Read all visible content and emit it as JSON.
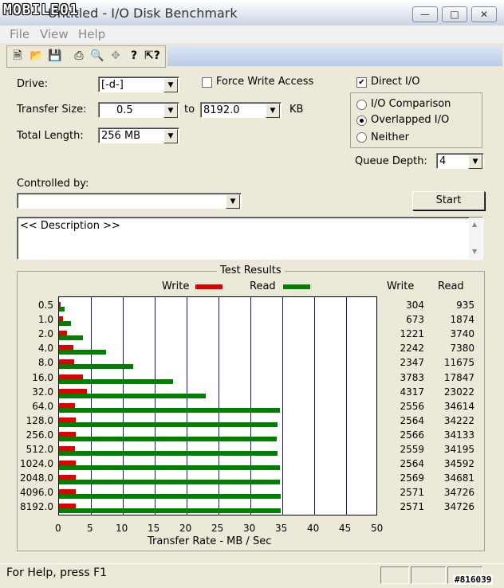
{
  "window": {
    "title": "Untitled - I/O Disk Benchmark",
    "watermark": "MOBILE01"
  },
  "menu": [
    "File",
    "View",
    "Help"
  ],
  "toolbar": [
    "new-icon",
    "open-icon",
    "save-icon",
    "print-icon",
    "print-preview-icon",
    "move-icon",
    "help-icon",
    "context-help-icon"
  ],
  "settings": {
    "drive_label": "Drive:",
    "drive_value": "[-d-]",
    "force_write_label": "Force Write Access",
    "transfer_label": "Transfer Size:",
    "transfer_from": "0.5",
    "to_label": "to",
    "transfer_to": "8192.0",
    "kb_label": "KB",
    "length_label": "Total Length:",
    "length_value": "256 MB",
    "direct_io_label": "Direct I/O",
    "io_comparison_label": "I/O Comparison",
    "overlapped_label": "Overlapped I/O",
    "neither_label": "Neither",
    "queue_label": "Queue Depth:",
    "queue_value": "4",
    "controlled_label": "Controlled by:",
    "controlled_value": "",
    "start_label": "Start",
    "description": "<< Description >>"
  },
  "chart_data": {
    "type": "bar",
    "title": "Test Results",
    "xlabel": "Transfer Rate - MB / Sec",
    "xlim": [
      0,
      50
    ],
    "xticks": [
      "0",
      "5",
      "10",
      "15",
      "20",
      "25",
      "30",
      "35",
      "40",
      "45",
      "50"
    ],
    "categories": [
      "0.5",
      "1.0",
      "2.0",
      "4.0",
      "8.0",
      "16.0",
      "32.0",
      "64.0",
      "128.0",
      "256.0",
      "512.0",
      "1024.0",
      "2048.0",
      "4096.0",
      "8192.0"
    ],
    "legend_write": "Write",
    "legend_read": "Read",
    "col_write": "Write",
    "col_read": "Read",
    "series": [
      {
        "name": "Write",
        "color": "#e00000",
        "values": [
          304,
          673,
          1221,
          2242,
          2347,
          3783,
          4317,
          2556,
          2564,
          2566,
          2559,
          2564,
          2569,
          2571,
          2571
        ]
      },
      {
        "name": "Read",
        "color": "#008000",
        "values": [
          935,
          1874,
          3740,
          7380,
          11675,
          17847,
          23022,
          34614,
          34222,
          34133,
          34195,
          34592,
          34681,
          34726,
          34726
        ]
      }
    ]
  },
  "status": {
    "help_text": "For Help, press F1",
    "corner_text": "#816039"
  }
}
